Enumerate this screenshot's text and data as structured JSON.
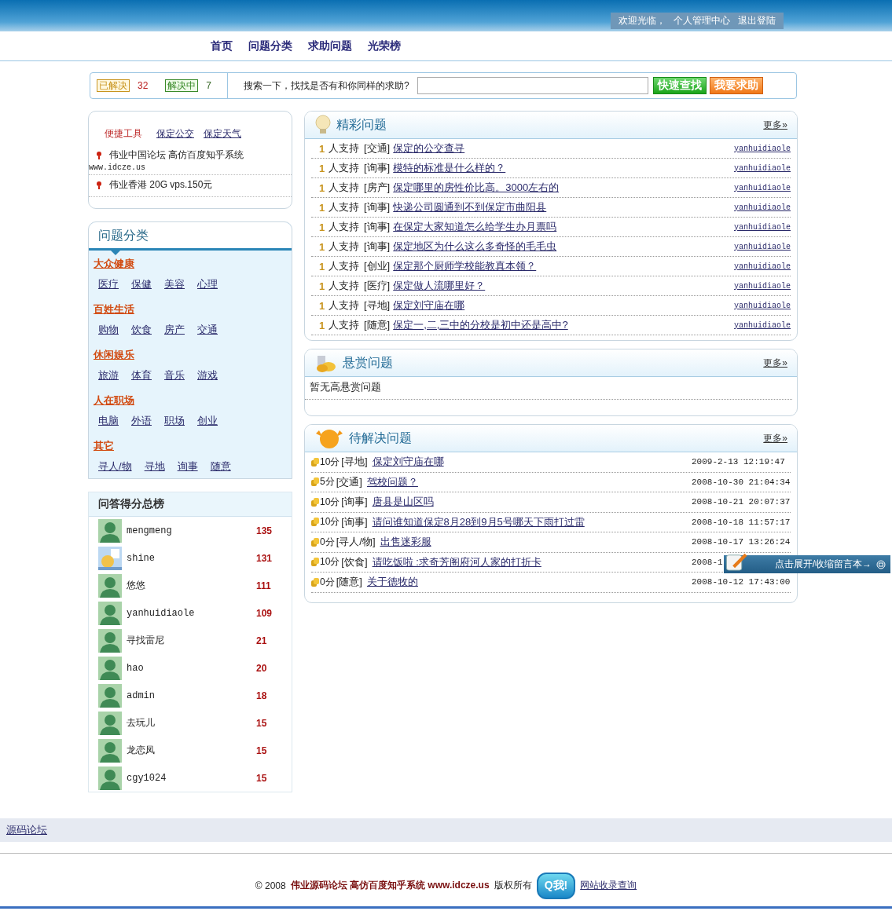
{
  "user_bar": {
    "greeting": "欢迎光临，",
    "links": [
      "个人管理中心",
      "退出登陆"
    ]
  },
  "nav": [
    "首页",
    "问题分类",
    "求助问题",
    "光荣榜"
  ],
  "stats": [
    {
      "kind": "solved",
      "label": "已解决",
      "count": "32"
    },
    {
      "kind": "pending",
      "label": "解决中",
      "count": "7"
    }
  ],
  "search": {
    "prompt": "搜索一下，找找是否有和你同样的求助?",
    "buttons": [
      {
        "kind": "search",
        "label": "快速查找"
      },
      {
        "kind": "ask",
        "label": "我要求助"
      }
    ]
  },
  "tools": {
    "title": "便捷工具",
    "links": [
      "保定公交",
      "保定天气"
    ],
    "notices": [
      {
        "text": "伟业中国论坛 高仿百度知乎系统",
        "url": "www.idcze.us"
      },
      {
        "text": "伟业香港 20G vps.150元"
      }
    ]
  },
  "categories": {
    "title": "问题分类",
    "groups": [
      {
        "name": "大众健康",
        "items": [
          "医疗",
          "保健",
          "美容",
          "心理"
        ]
      },
      {
        "name": "百姓生活",
        "items": [
          "购物",
          "饮食",
          "房产",
          "交通"
        ]
      },
      {
        "name": "休闲娱乐",
        "items": [
          "旅游",
          "体育",
          "音乐",
          "游戏"
        ]
      },
      {
        "name": "人在职场",
        "items": [
          "电脑",
          "外语",
          "职场",
          "创业"
        ]
      },
      {
        "name": "其它",
        "items": [
          "寻人/物",
          "寻地",
          "询事",
          "随意"
        ]
      }
    ]
  },
  "leaderboard": {
    "title": "问答得分总榜",
    "users": [
      {
        "name": "mengmeng",
        "score": "135",
        "kind": "default"
      },
      {
        "name": "shine",
        "score": "131",
        "kind": "custom"
      },
      {
        "name": "悠悠",
        "score": "111",
        "kind": "default"
      },
      {
        "name": "yanhuidiaole",
        "score": "109",
        "kind": "default"
      },
      {
        "name": "寻找雷尼",
        "score": "21",
        "kind": "default"
      },
      {
        "name": "hao",
        "score": "20",
        "kind": "default"
      },
      {
        "name": "admin",
        "score": "18",
        "kind": "default"
      },
      {
        "name": "去玩儿",
        "score": "15",
        "kind": "default"
      },
      {
        "name": "龙恋凤",
        "score": "15",
        "kind": "default"
      },
      {
        "name": "cgy1024",
        "score": "15",
        "kind": "default"
      }
    ]
  },
  "featured": {
    "title": "精彩问题",
    "more": "更多»",
    "rows": [
      {
        "count": "1",
        "support": "人支持",
        "tag": "[交通]",
        "title": "保定的公交查寻",
        "user": "yanhuidiaole"
      },
      {
        "count": "1",
        "support": "人支持",
        "tag": "[询事]",
        "title": "模特的标准是什么样的？",
        "user": "yanhuidiaole"
      },
      {
        "count": "1",
        "support": "人支持",
        "tag": "[房产]",
        "title": "保定哪里的房性价比高。3000左右的",
        "user": "yanhuidiaole"
      },
      {
        "count": "1",
        "support": "人支持",
        "tag": "[询事]",
        "title": "快递公司圆通到不到保定市曲阳县",
        "user": "yanhuidiaole"
      },
      {
        "count": "1",
        "support": "人支持",
        "tag": "[询事]",
        "title": "在保定大家知道怎么给学生办月票吗",
        "user": "yanhuidiaole"
      },
      {
        "count": "1",
        "support": "人支持",
        "tag": "[询事]",
        "title": "保定地区为什么这么多奇怪的毛毛虫",
        "user": "yanhuidiaole"
      },
      {
        "count": "1",
        "support": "人支持",
        "tag": "[创业]",
        "title": "保定那个厨师学校能教真本领？",
        "user": "yanhuidiaole"
      },
      {
        "count": "1",
        "support": "人支持",
        "tag": "[医疗]",
        "title": "保定做人流哪里好？",
        "user": "yanhuidiaole"
      },
      {
        "count": "1",
        "support": "人支持",
        "tag": "[寻地]",
        "title": "保定刘守庙在哪",
        "user": "yanhuidiaole"
      },
      {
        "count": "1",
        "support": "人支持",
        "tag": "[随意]",
        "title": "保定一,二,三中的分校是初中还是高中?",
        "user": "yanhuidiaole"
      }
    ]
  },
  "reward": {
    "title": "悬赏问题",
    "more": "更多»",
    "empty": "暂无高悬赏问题"
  },
  "pending": {
    "title": "待解决问题",
    "more": "更多»",
    "rows": [
      {
        "points": "10分",
        "tag": "[寻地]",
        "title": "保定刘守庙在哪",
        "time": "2009-2-13 12:19:47"
      },
      {
        "points": "5分",
        "tag": "[交通]",
        "title": "驾校问题？",
        "time": "2008-10-30 21:04:34"
      },
      {
        "points": "10分",
        "tag": "[询事]",
        "title": "唐县是山区吗",
        "time": "2008-10-21 20:07:37"
      },
      {
        "points": "10分",
        "tag": "[询事]",
        "title": "请问谁知道保定8月28到9月5号哪天下雨打过雷",
        "time": "2008-10-18 11:57:17"
      },
      {
        "points": "0分",
        "tag": "[寻人/物]",
        "title": "出售迷彩服",
        "time": "2008-10-17 13:26:24"
      },
      {
        "points": "10分",
        "tag": "[饮食]",
        "title": "请吃饭啦 :求奇芳阁府河人家的打折卡",
        "time": "2008-1"
      },
      {
        "points": "0分",
        "tag": "[随意]",
        "title": "关于德牧的",
        "time": "2008-10-12 17:43:00"
      }
    ]
  },
  "forum_link": "源码论坛",
  "footer": {
    "mark": "©",
    "year": "2008",
    "name": "伟业源码论坛 高仿百度知乎系统 www.idcze.us",
    "rights": "版权所有",
    "qq": "Q我!",
    "link": "网站收录查询"
  },
  "floating": {
    "label": "点击展开/收缩留言本→"
  }
}
